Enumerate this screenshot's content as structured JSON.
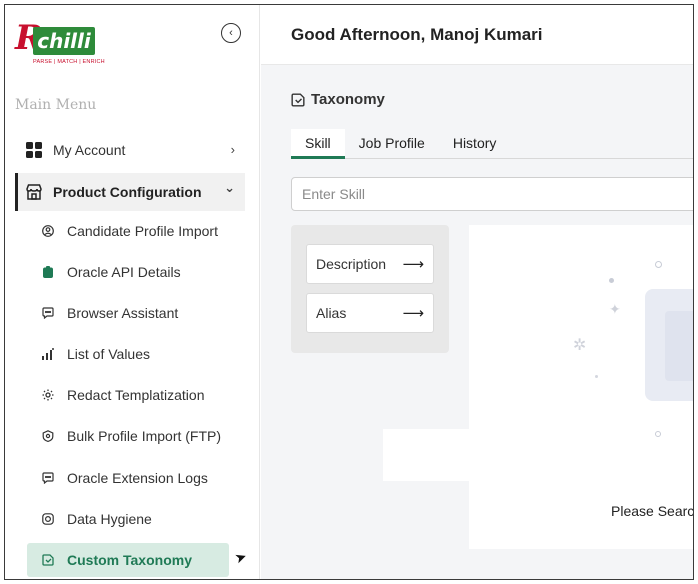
{
  "brand": {
    "logo_letter": "R",
    "logo_word": "chilli",
    "tagline": "PARSE | MATCH | ENRICH",
    "colors": {
      "red": "#c8102e",
      "green": "#2e8b3a",
      "accent": "#1f7a55",
      "active_bg": "#d7ebe2"
    }
  },
  "sidebar": {
    "collapse_icon": "chevron-left-circle-icon",
    "menu_heading": "Main Menu",
    "items": [
      {
        "label": "My Account",
        "icon": "grid-icon",
        "chevron": "›"
      },
      {
        "label": "Product Configuration",
        "icon": "store-icon",
        "chevron": "⌄"
      }
    ],
    "sub_items": [
      {
        "label": "Candidate Profile Import",
        "icon": "user-circle-icon"
      },
      {
        "label": "Oracle API Details",
        "icon": "clipboard-icon"
      },
      {
        "label": "Browser Assistant",
        "icon": "chat-icon"
      },
      {
        "label": "List of Values",
        "icon": "chart-icon"
      },
      {
        "label": "Redact Templatization",
        "icon": "gear-icon"
      },
      {
        "label": "Bulk Profile Import (FTP)",
        "icon": "badge-icon"
      },
      {
        "label": "Oracle Extension Logs",
        "icon": "chat-icon"
      },
      {
        "label": "Data Hygiene",
        "icon": "target-icon"
      },
      {
        "label": "Custom Taxonomy",
        "icon": "taxonomy-icon",
        "active": true
      }
    ]
  },
  "header": {
    "greeting": "Good Afternoon, Manoj Kumari"
  },
  "taxonomy": {
    "title": "Taxonomy",
    "tabs": [
      {
        "label": "Skill",
        "active": true
      },
      {
        "label": "Job Profile"
      },
      {
        "label": "History"
      }
    ],
    "search": {
      "placeholder": "Enter Skill",
      "value": ""
    },
    "panel_buttons": [
      {
        "label": "Description",
        "arrow": "⟶"
      },
      {
        "label": "Alias",
        "arrow": "⟶"
      }
    ],
    "empty_state": "Please Search"
  }
}
